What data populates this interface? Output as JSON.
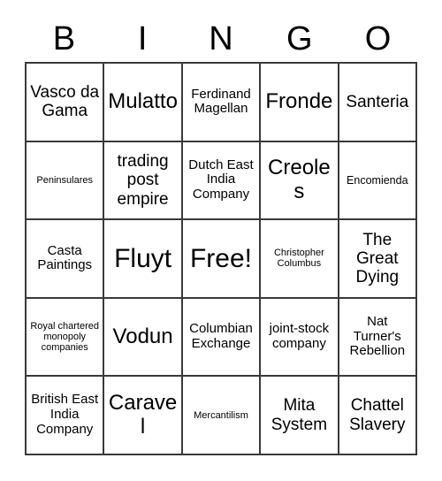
{
  "header": {
    "letters": [
      "B",
      "I",
      "N",
      "G",
      "O"
    ]
  },
  "grid": {
    "columns": 5,
    "rows": 5,
    "border_color": "#3a3a3a",
    "background_color": "#ffffff",
    "text_color": "#000000",
    "cells": [
      {
        "text": "Vasco da Gama",
        "size": "md"
      },
      {
        "text": "Mulatto",
        "size": "lg"
      },
      {
        "text": "Ferdinand Magellan",
        "size": "sm"
      },
      {
        "text": "Fronde",
        "size": "lg"
      },
      {
        "text": "Santeria",
        "size": "md"
      },
      {
        "text": "Peninsulares",
        "size": "xxs"
      },
      {
        "text": "trading post empire",
        "size": "md"
      },
      {
        "text": "Dutch East India Company",
        "size": "sm"
      },
      {
        "text": "Creoles",
        "size": "lg"
      },
      {
        "text": "Encomienda",
        "size": "xs"
      },
      {
        "text": "Casta Paintings",
        "size": "sm"
      },
      {
        "text": "Fluyt",
        "size": "xl"
      },
      {
        "text": "Free!",
        "size": "xl"
      },
      {
        "text": "Christopher Columbus",
        "size": "xxs"
      },
      {
        "text": "The Great Dying",
        "size": "md"
      },
      {
        "text": "Royal chartered monopoly companies",
        "size": "xxs"
      },
      {
        "text": "Vodun",
        "size": "lg"
      },
      {
        "text": "Columbian Exchange",
        "size": "sm"
      },
      {
        "text": "joint-stock company",
        "size": "sm"
      },
      {
        "text": "Nat Turner's Rebellion",
        "size": "sm"
      },
      {
        "text": "British East India Company",
        "size": "sm"
      },
      {
        "text": "Caravel",
        "size": "lg"
      },
      {
        "text": "Mercantilism",
        "size": "xxs"
      },
      {
        "text": "Mita System",
        "size": "md"
      },
      {
        "text": "Chattel Slavery",
        "size": "md"
      }
    ]
  }
}
